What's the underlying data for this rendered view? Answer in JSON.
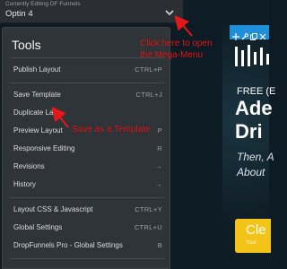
{
  "topbar": {
    "caption": "Currently Editing DF Funnels",
    "funnel_name": "Optin 4",
    "chevron_icon": "chevron-down-icon"
  },
  "menu": {
    "title": "Tools",
    "items": [
      {
        "label": "Publish Layout",
        "shortcut": "CTRL+P"
      },
      {
        "label": "Save Template",
        "shortcut": "CTRL+J"
      },
      {
        "label": "Duplicate Layo",
        "shortcut": ""
      },
      {
        "label": "Preview Layout",
        "shortcut": "P"
      },
      {
        "label": "Responsive Editing",
        "shortcut": "R"
      },
      {
        "label": "Revisions",
        "shortcut": "→"
      },
      {
        "label": "History",
        "shortcut": "→"
      },
      {
        "label": "Layout CSS & Javascript",
        "shortcut": "CTRL+Y"
      },
      {
        "label": "Global Settings",
        "shortcut": "CTRL+U"
      },
      {
        "label": "DropFunnels Pro - Global Settings",
        "shortcut": "B"
      }
    ]
  },
  "annotations": {
    "mega_menu_line1": "Click here to open",
    "mega_menu_line2": "the Mega-Menu",
    "save_template": "Save as a Template"
  },
  "preview": {
    "hero_small": "FREE (E",
    "hero_line1": "Ade",
    "hero_line2": "Dri",
    "hero_italic1": "Then, A",
    "hero_italic2": "About",
    "cta_main": "Cle",
    "cta_sub": "Your"
  },
  "colors": {
    "annotation": "#e4181b",
    "cta": "#f3c417",
    "toolbar": "#1e8fd8",
    "menu_bg": "#2f3438"
  }
}
